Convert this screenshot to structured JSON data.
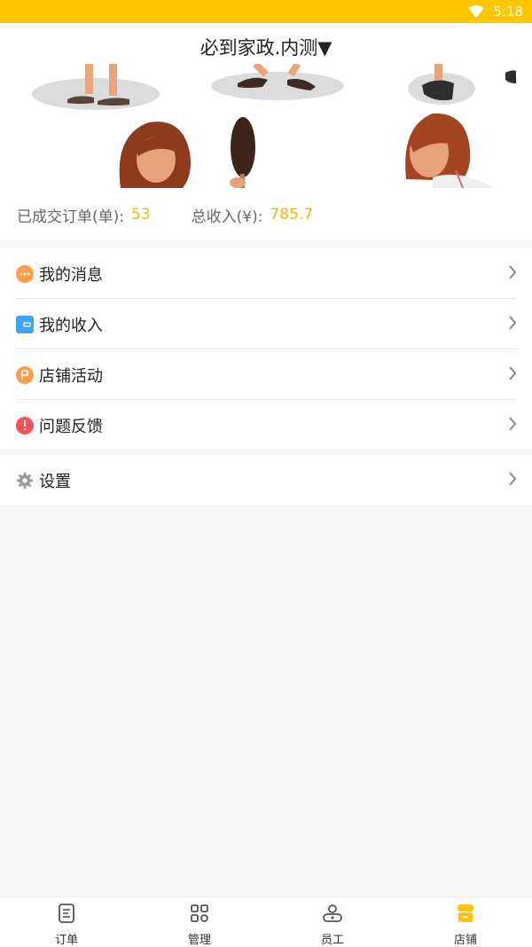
{
  "status_bar": {
    "time": "5:18",
    "icons": [
      "wifi-icon"
    ],
    "background_color": "#ffc600"
  },
  "header": {
    "title": "必到家政.内测▼"
  },
  "stats": {
    "orders_label": "已成交订单(单):",
    "orders_value": "53",
    "income_label": "总收入(¥):",
    "income_value": "785.7",
    "value_color": "#f5b800"
  },
  "menu": {
    "items": [
      {
        "label": "我的消息",
        "icon": "message-icon",
        "color": "#ff9e4a"
      },
      {
        "label": "我的收入",
        "icon": "wallet-icon",
        "color": "#3ea4f0"
      },
      {
        "label": "店铺活动",
        "icon": "flag-icon",
        "color": "#ff9e4a"
      },
      {
        "label": "问题反馈",
        "icon": "exclamation-icon",
        "color": "#f4525a"
      }
    ],
    "settings": {
      "label": "设置",
      "icon": "gear-icon",
      "color": "#9a9a9a"
    }
  },
  "tabbar": {
    "tabs": [
      {
        "label": "订单",
        "icon": "order-icon",
        "active": false
      },
      {
        "label": "管理",
        "icon": "manage-icon",
        "active": false
      },
      {
        "label": "员工",
        "icon": "staff-icon",
        "active": false
      },
      {
        "label": "店铺",
        "icon": "store-icon",
        "active": true
      }
    ],
    "active_color": "#ffc600"
  }
}
